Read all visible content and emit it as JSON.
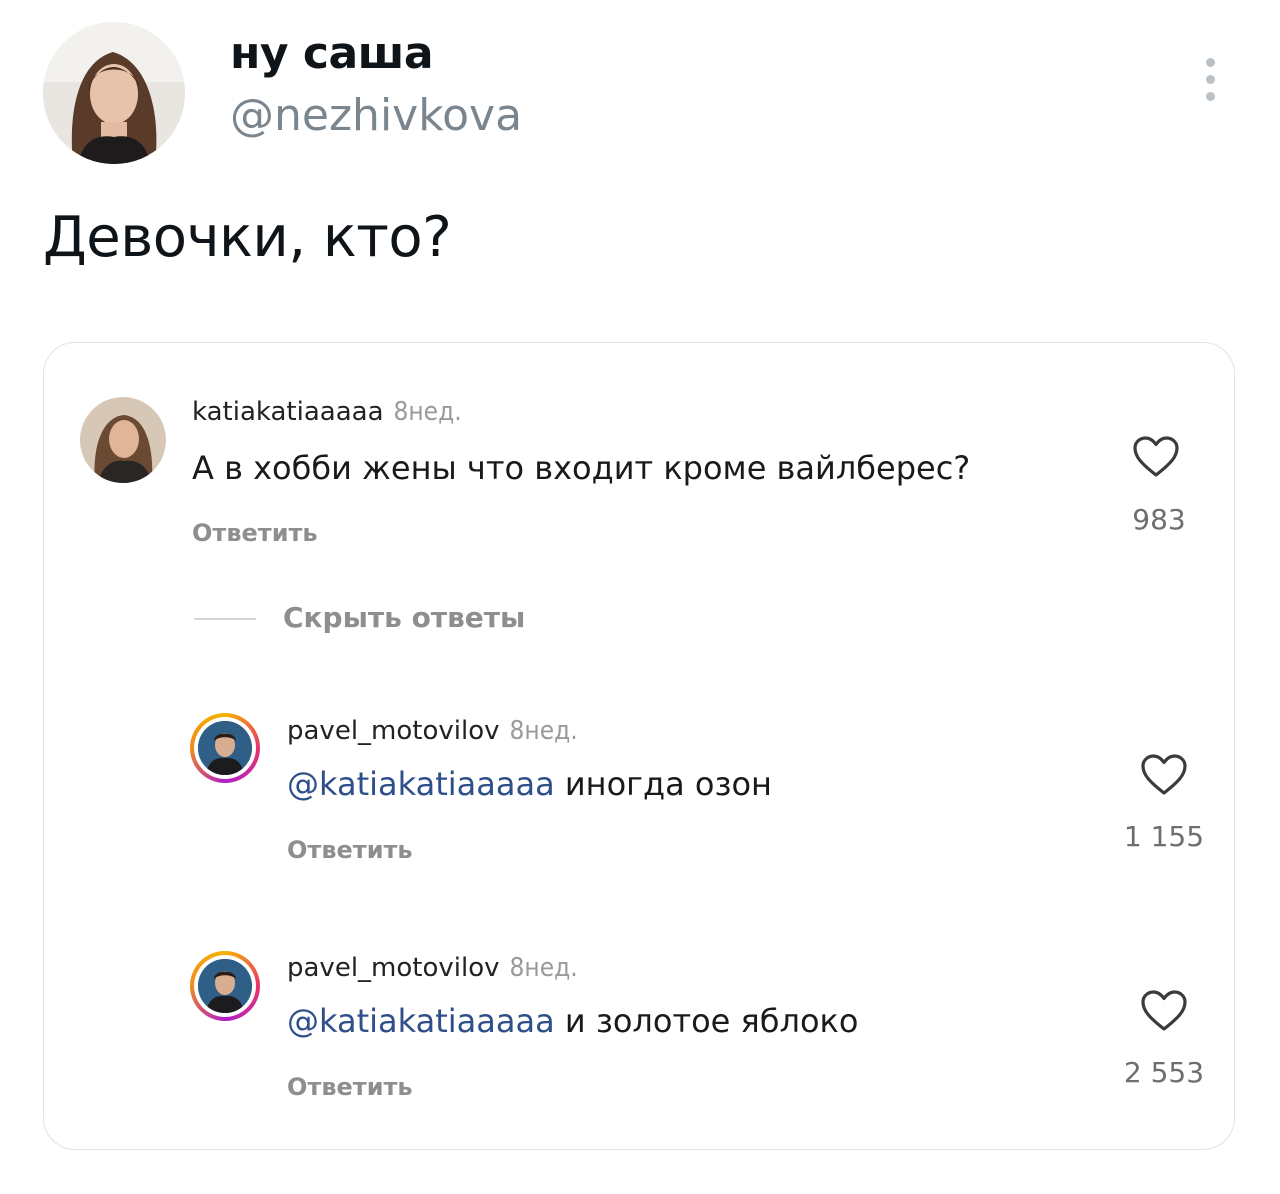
{
  "tweet": {
    "display_name": "ну саша",
    "handle": "@nezhivkova",
    "text": "Девочки, кто?",
    "more_icon": "more-vertical-icon"
  },
  "comments": {
    "hide_replies_label": "Скрыть ответы",
    "items": [
      {
        "username": "katiakatiaaaaa",
        "age": "8нед.",
        "mention": "",
        "text": "А в хобби жены что входит кроме вайлберес?",
        "reply_label": "Ответить",
        "likes": "983",
        "like_icon": "heart-icon"
      },
      {
        "username": "pavel_motovilov",
        "age": "8нед.",
        "mention": "@katiakatiaaaaa",
        "text": "иногда озон",
        "reply_label": "Ответить",
        "likes": "1 155",
        "like_icon": "heart-icon"
      },
      {
        "username": "pavel_motovilov",
        "age": "8нед.",
        "mention": "@katiakatiaaaaa",
        "text": "и золотое яблоко",
        "reply_label": "Ответить",
        "likes": "2 553",
        "like_icon": "heart-icon"
      }
    ]
  },
  "colors": {
    "mention": "#2f4f8a",
    "story_ring": "#e8336b",
    "handle": "#7b858e"
  }
}
